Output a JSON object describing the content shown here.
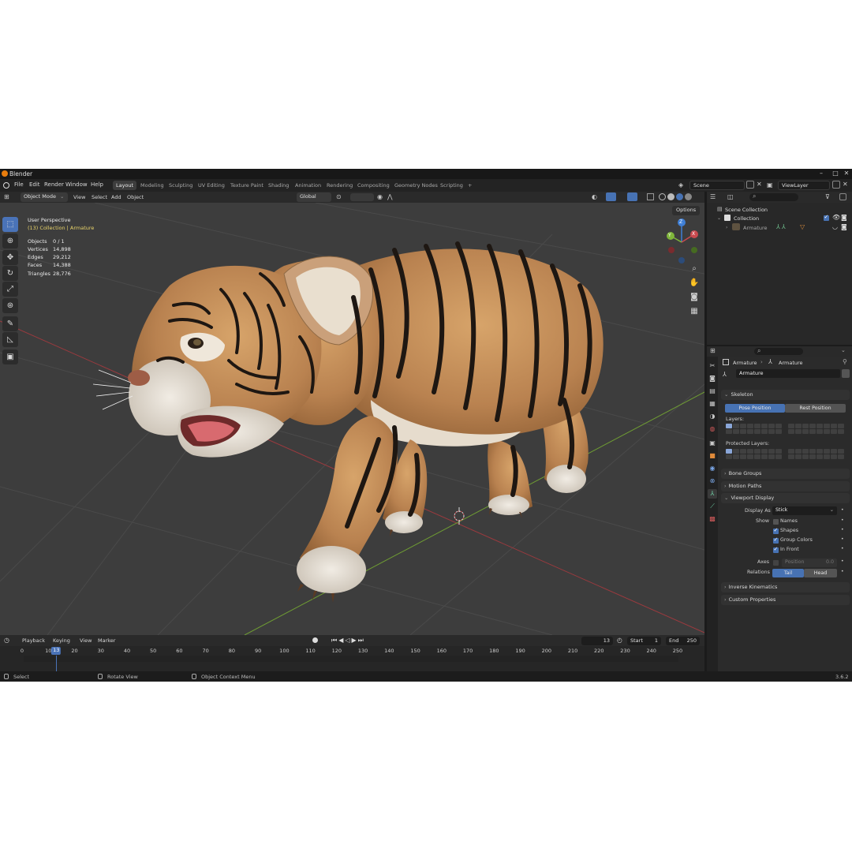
{
  "titlebar": {
    "app_name": "Blender",
    "min": "–",
    "max": "□",
    "close": "✕"
  },
  "menu": [
    "File",
    "Edit",
    "Render",
    "Window",
    "Help"
  ],
  "workspaces": [
    "Layout",
    "Modeling",
    "Sculpting",
    "UV Editing",
    "Texture Paint",
    "Shading",
    "Animation",
    "Rendering",
    "Compositing",
    "Geometry Nodes",
    "Scripting",
    "+"
  ],
  "scene": {
    "scene_name": "Scene",
    "view_layer": "ViewLayer"
  },
  "viewport_header": {
    "mode": "Object Mode",
    "menus": [
      "View",
      "Select",
      "Add",
      "Object"
    ],
    "transform_orientation": "Global",
    "options": "Options"
  },
  "viewport": {
    "perspective_label": "User Perspective",
    "collection_label": "(13) Collection | Armature",
    "stats": [
      {
        "label": "Objects",
        "value": "0 / 1"
      },
      {
        "label": "Vertices",
        "value": "14,898"
      },
      {
        "label": "Edges",
        "value": "29,212"
      },
      {
        "label": "Faces",
        "value": "14,388"
      },
      {
        "label": "Triangles",
        "value": "28,776"
      }
    ],
    "gizmo_axes": {
      "z": "Z",
      "y": "Y",
      "x": "X"
    }
  },
  "timeline": {
    "menus": [
      "Playback",
      "Keying",
      "View",
      "Marker"
    ],
    "current_frame": "13",
    "start_label": "Start",
    "start": "1",
    "end_label": "End",
    "end": "250",
    "ticks": [
      "0",
      "10",
      "20",
      "30",
      "40",
      "50",
      "60",
      "70",
      "80",
      "90",
      "100",
      "110",
      "120",
      "130",
      "140",
      "150",
      "160",
      "170",
      "180",
      "190",
      "200",
      "210",
      "220",
      "230",
      "240",
      "250"
    ]
  },
  "statusbar": {
    "select": "Select",
    "rotate": "Rotate View",
    "context": "Object Context Menu",
    "version": "3.6.2"
  },
  "outliner": {
    "scene_collection": "Scene Collection",
    "collection": "Collection",
    "armature": "Armature"
  },
  "properties": {
    "breadcrumb_object": "Armature",
    "breadcrumb_data": "Armature",
    "data_name": "Armature",
    "skeleton": {
      "title": "Skeleton",
      "pose_position": "Pose Position",
      "rest_position": "Rest Position",
      "layers": "Layers:",
      "protected_layers": "Protected Layers:"
    },
    "bone_groups": "Bone Groups",
    "motion_paths": "Motion Paths",
    "viewport_display": {
      "title": "Viewport Display",
      "display_as_label": "Display As",
      "display_as_value": "Stick",
      "show_label": "Show",
      "names": "Names",
      "shapes": "Shapes",
      "group_colors": "Group Colors",
      "in_front": "In Front",
      "axes_label": "Axes",
      "position_label": "Position",
      "position_value": "0.0",
      "relations_label": "Relations",
      "tail": "Tail",
      "head": "Head"
    },
    "inverse_kinematics": "Inverse Kinematics",
    "custom_properties": "Custom Properties"
  },
  "colors": {
    "accent": "#4772b3",
    "tiger_fur": "#c8925a",
    "stripe": "#1e1712",
    "x_axis": "#c94a4f",
    "y_axis": "#7fb63a",
    "z_axis": "#3f7fd6"
  }
}
